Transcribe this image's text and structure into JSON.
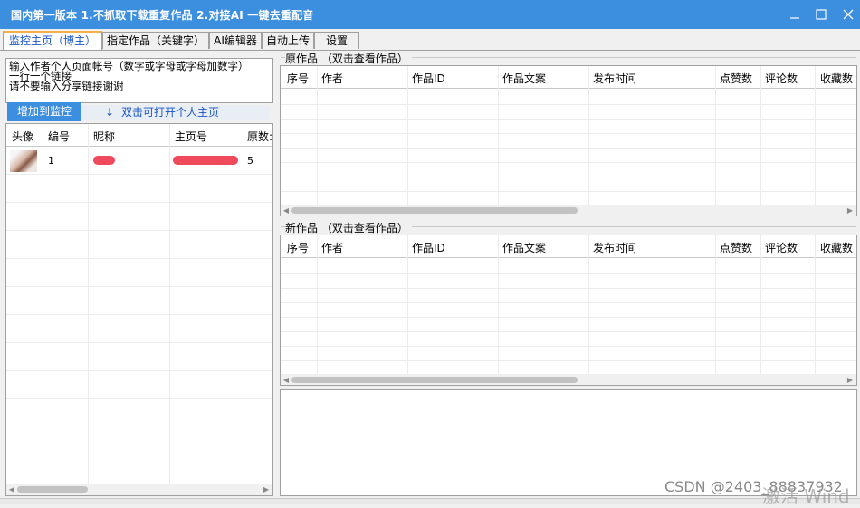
{
  "window": {
    "title": "国内第一版本 1.不抓取下载重复作品 2.对接AI 一键去重配音",
    "minimize_icon": "minimize-icon",
    "maximize_icon": "maximize-icon",
    "close_icon": "close-icon"
  },
  "tabs": [
    {
      "label": "监控主页（博主）",
      "active": true
    },
    {
      "label": "指定作品（关键字）",
      "active": false
    },
    {
      "label": "AI编辑器",
      "active": false
    },
    {
      "label": "自动上传",
      "active": false
    },
    {
      "label": "设置",
      "active": false
    }
  ],
  "left": {
    "instructions": [
      "输入作者个人页面帐号（数字或字母或字母加数字）",
      "一行一个链接",
      "请不要输入分享链接谢谢"
    ],
    "add_button": "增加到监控",
    "hint_arrow": "↓",
    "hint_text": "双击可打开个人主页",
    "columns": [
      "头像",
      "编号",
      "昵称",
      "主页号",
      "原数:"
    ],
    "rows": [
      {
        "index": "1",
        "count": "5"
      }
    ]
  },
  "original_works": {
    "group_label": "原作品 （双击查看作品）",
    "columns": [
      "序号",
      "作者",
      "作品ID",
      "作品文案",
      "发布时间",
      "点赞数",
      "评论数",
      "收藏数"
    ]
  },
  "new_works": {
    "group_label": "新作品 （双击查看作品）",
    "columns": [
      "序号",
      "作者",
      "作品ID",
      "作品文案",
      "发布时间",
      "点赞数",
      "评论数",
      "收藏数"
    ]
  },
  "watermark": "CSDN @2403_88837932",
  "watermark2": "激活 Wind",
  "colors": {
    "titlebar": "#3c8ede",
    "accent": "#1a56c8",
    "redacted": "#ee4a5c"
  }
}
